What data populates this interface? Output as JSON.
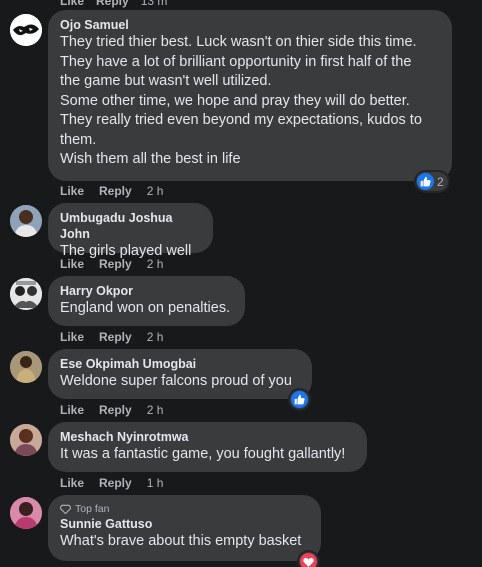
{
  "top_remnant": {
    "like": "Like",
    "reply": "Reply",
    "time": "13 m"
  },
  "comments": [
    {
      "author": "Ojo Samuel",
      "lines": [
        "They tried thier best. Luck wasn't on thier side this time.",
        "They have a lot of brilliant opportunity in first half of the",
        "the game but wasn't well utilized.",
        "Some other time, we hope and pray they will do better.",
        "They really tried even beyond my expectations, kudos to",
        "them.",
        "Wish them all the best in life"
      ],
      "like": "Like",
      "reply": "Reply",
      "time": "2 h",
      "reaction": {
        "icon": "like-icon",
        "count": "2"
      }
    },
    {
      "author": "Umbugadu Joshua John",
      "lines": [
        "The girls played well"
      ],
      "like": "Like",
      "reply": "Reply",
      "time": "2 h"
    },
    {
      "author": "Harry Okpor",
      "lines": [
        "England won on penalties."
      ],
      "like": "Like",
      "reply": "Reply",
      "time": "2 h"
    },
    {
      "author": "Ese Okpimah Umogbai",
      "lines": [
        "Weldone super falcons proud of you"
      ],
      "like": "Like",
      "reply": "Reply",
      "time": "2 h",
      "reaction": {
        "icon": "like-icon",
        "count": ""
      }
    },
    {
      "author": "Meshach Nyinrotmwa",
      "lines": [
        "It was a fantastic game, you fought gallantly!"
      ],
      "like": "Like",
      "reply": "Reply",
      "time": "1 h"
    },
    {
      "badge": "Top fan",
      "author": "Sunnie Gattuso",
      "lines": [
        "What's brave about this empty basket"
      ],
      "reaction": {
        "icon": "love-icon",
        "count": ""
      }
    }
  ],
  "colors": {
    "background": "#18191a",
    "bubble": "#3a3b3c",
    "text": "#e4e6eb",
    "muted": "#b0b3b8",
    "like_blue": "#1877f2",
    "love_red": "#f33e58"
  }
}
